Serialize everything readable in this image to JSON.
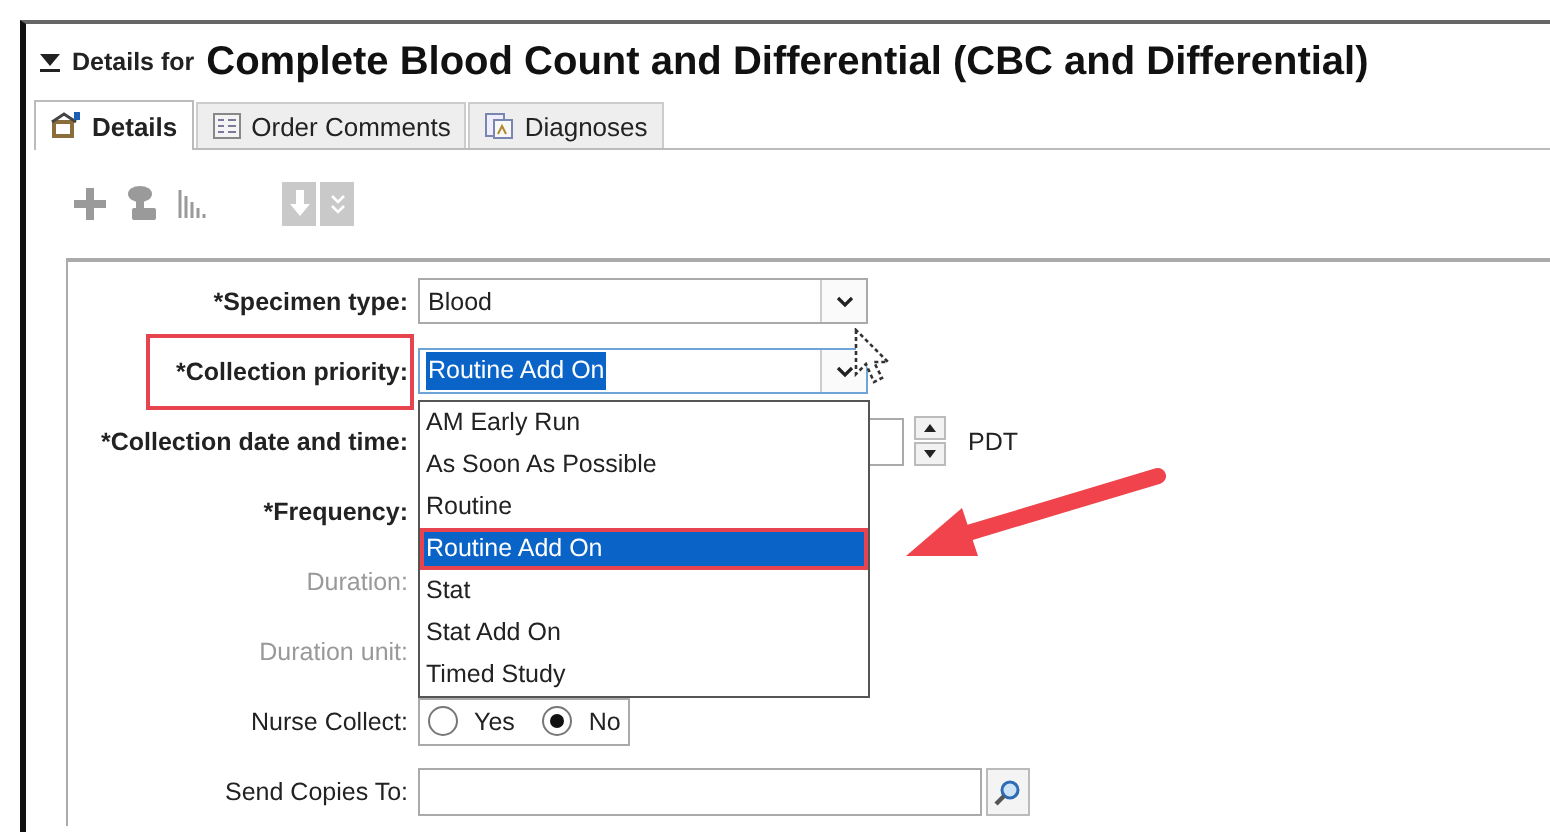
{
  "header": {
    "expanded": true,
    "prefix": "Details for",
    "title": "Complete Blood Count and Differential (CBC and Differential)"
  },
  "tabs": [
    {
      "label": "Details",
      "selected": true
    },
    {
      "label": "Order Comments",
      "selected": false
    },
    {
      "label": "Diagnoses",
      "selected": false
    }
  ],
  "fields": [
    {
      "kind": "select",
      "label": "*Specimen type:",
      "value": "Blood",
      "disabled": false
    },
    {
      "kind": "select",
      "label": "*Collection priority:",
      "value": "Routine Add On",
      "disabled": false,
      "highlighted": true,
      "open": true
    },
    {
      "kind": "datetime",
      "label": "*Collection date and time:",
      "zone": "PDT",
      "disabled": false
    },
    {
      "kind": "covered",
      "label": "*Frequency:",
      "disabled": false
    },
    {
      "kind": "covered",
      "label": "Duration:",
      "disabled": true
    },
    {
      "kind": "covered",
      "label": "Duration unit:",
      "disabled": true
    },
    {
      "kind": "radio",
      "label": "Nurse Collect:",
      "disabled": false,
      "options": [
        {
          "label": "Yes",
          "selected": false
        },
        {
          "label": "No",
          "selected": true
        }
      ]
    },
    {
      "kind": "lookup",
      "label": "Send Copies To:",
      "disabled": false
    }
  ],
  "dropdown": {
    "options": [
      {
        "label": "AM Early Run",
        "selected": false,
        "highlighted": false
      },
      {
        "label": "As Soon As Possible",
        "selected": false,
        "highlighted": false
      },
      {
        "label": "Routine",
        "selected": false,
        "highlighted": false
      },
      {
        "label": "Routine Add On",
        "selected": true,
        "highlighted": true
      },
      {
        "label": "Stat",
        "selected": false,
        "highlighted": false
      },
      {
        "label": "Stat Add On",
        "selected": false,
        "highlighted": false
      },
      {
        "label": "Timed Study",
        "selected": false,
        "highlighted": false
      }
    ]
  }
}
